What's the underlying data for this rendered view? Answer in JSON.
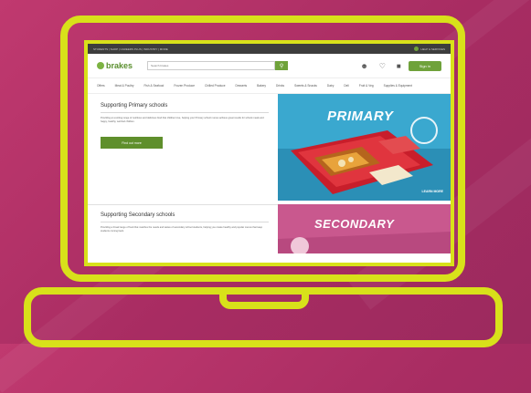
{
  "browser": {
    "topbar_text": "STUDENTS | SHOP | CAREERS PLUS | INDUSTRY | MORE",
    "topbar_right": "HELP & SERVICES"
  },
  "header": {
    "logo": "brakes",
    "search_placeholder": "Search brakes",
    "signin_label": "Sign in"
  },
  "nav": {
    "items": [
      "Offers",
      "Meat & Poultry",
      "Fish & Seafood",
      "Frozen Produce",
      "Chilled Produce",
      "Desserts",
      "Bakery",
      "Drinks",
      "Sweets & Snacks",
      "Dairy",
      "Deli",
      "Fruit & Veg",
      "Supplies & Equipment"
    ]
  },
  "primary": {
    "title": "Supporting Primary schools",
    "text": "Providing an exciting range of nutritious and delicious food that children love, helping your Primary school menus achieve great results for school meals and happy, healthy, well-fed children.",
    "cta": "Find out more",
    "hero_label": "PRIMARY",
    "hero_sub": "LEARN MORE"
  },
  "secondary": {
    "title": "Supporting Secondary schools",
    "text": "Providing a broad range of food that matches the needs and tastes of secondary school students, helping you create healthy and popular menus that keep students coming back.",
    "hero_label": "SECONDARY"
  },
  "colors": {
    "background": "#b23468",
    "laptop_outline": "#d8e11a",
    "brand_green": "#6fa23a",
    "hero_primary": "#2a9ec7",
    "hero_secondary": "#c54e86"
  },
  "icons": {
    "user": "user-icon",
    "heart": "heart-icon",
    "truck": "truck-icon",
    "search": "search-icon"
  }
}
